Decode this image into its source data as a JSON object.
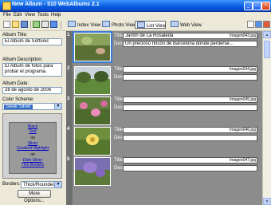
{
  "window": {
    "title": "New Album - 510 WebAlbums 2.1",
    "controls": {
      "minimize": "_",
      "maximize": "□",
      "close": "×"
    }
  },
  "menu": [
    "File",
    "Edit",
    "View",
    "Tools",
    "Help"
  ],
  "toolbar": {
    "icons": [
      "new-icon",
      "open-icon",
      "save-icon",
      "add-photos-icon",
      "publish-icon"
    ],
    "views": [
      {
        "label": "Index View",
        "active": false
      },
      {
        "label": "Photo View",
        "active": false
      },
      {
        "label": "List View",
        "active": true
      },
      {
        "label": "Web View",
        "active": false
      }
    ],
    "right_icons": [
      "settings-icon",
      "help-icon",
      "exit-icon"
    ]
  },
  "sidebar": {
    "album_title_label": "Album Title:",
    "album_title_value": "El Album de Softonic",
    "album_description_label": "Album Description:",
    "album_description_value": "El Album de fotos para probar el programa.",
    "album_date_label": "Album Date:",
    "album_date_value": "28 de agosto de 2006",
    "color_scheme_label": "Color Scheme:",
    "color_scheme_value": "Sleek Silver",
    "preview_lines": [
      {
        "text": "Black",
        "link": true
      },
      {
        "text": "Text",
        "link": true
      },
      {
        "text": "on",
        "link": false
      },
      {
        "text": "Silver",
        "link": true
      },
      {
        "text": "Gradient Highlight",
        "link": true
      },
      {
        "text": "on",
        "link": false
      },
      {
        "text": "Dark Silver",
        "link": true
      },
      {
        "text": "Thin Borders",
        "link": true
      }
    ],
    "borders_label": "Borders:",
    "borders_value": "Thick/Rounded",
    "more_options_label": "More Options..."
  },
  "album": {
    "title_label": "Title:",
    "desc_label": "Desc:",
    "rows": [
      {
        "number": "1",
        "title": "Jardín de La Rosaleda",
        "desc": "Un precioso rincón de Barcelona donde perderse...",
        "filename": "Imagen043.jpg",
        "thumb": "garden-bench-photo",
        "selected": true
      },
      {
        "number": "2",
        "title": "",
        "desc": "",
        "filename": "Imagen044.jpg",
        "thumb": "park-lawn-photo",
        "selected": false
      },
      {
        "number": "3",
        "title": "",
        "desc": "",
        "filename": "Imagen045.jpg",
        "thumb": "pink-roses-photo",
        "selected": false
      },
      {
        "number": "4",
        "title": "",
        "desc": "",
        "filename": "Imagen046.jpg",
        "thumb": "yellow-flower-photo",
        "selected": false
      },
      {
        "number": "5",
        "title": "",
        "desc": "",
        "filename": "Imagen047.jpg",
        "thumb": "purple-flower-photo",
        "selected": false
      }
    ]
  }
}
